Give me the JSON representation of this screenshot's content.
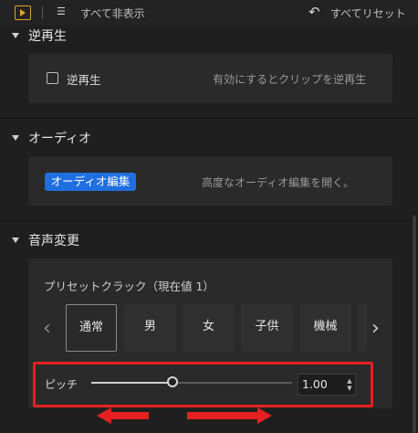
{
  "toolbar": {
    "hide_all_label": "すべて非表示",
    "reset_all_label": "すべてリセット",
    "icons": [
      "play-frame-icon",
      "hide-list-icon",
      "reset-arrow-icon"
    ]
  },
  "reverse": {
    "title": "逆再生",
    "checkbox_label": "逆再生",
    "checked": false,
    "description": "有効にするとクリップを逆再生"
  },
  "audio": {
    "title": "オーディオ",
    "button_label": "オーディオ編集",
    "description": "高度なオーディオ編集を開く。"
  },
  "voice_change": {
    "title": "音声変更",
    "preset_label": "プリセットクラック（現在値 1）",
    "presets": [
      "通常",
      "男",
      "女",
      "子供",
      "機械"
    ],
    "selected_preset": "通常",
    "pitch_label": "ピッチ",
    "pitch_value": "1.00",
    "pitch_fraction": 0.41
  },
  "colors": {
    "accent_blue": "#1f6fe0",
    "annotation_red": "#e62020",
    "play_icon": "#e0a22a"
  }
}
